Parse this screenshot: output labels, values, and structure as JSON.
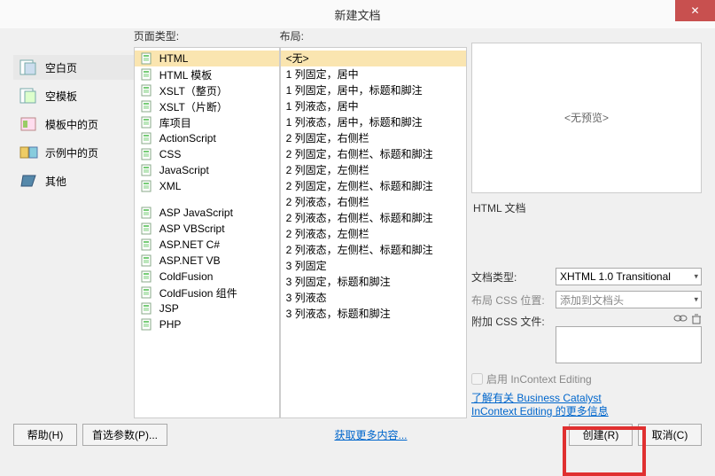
{
  "title": "新建文档",
  "close": "✕",
  "categories_label": "",
  "categories": [
    {
      "label": "空白页",
      "selected": true
    },
    {
      "label": "空模板",
      "selected": false
    },
    {
      "label": "模板中的页",
      "selected": false
    },
    {
      "label": "示例中的页",
      "selected": false
    },
    {
      "label": "其他",
      "selected": false
    }
  ],
  "page_type_label": "页面类型:",
  "page_types_a": [
    "HTML",
    "HTML 模板",
    "XSLT（整页）",
    "XSLT（片断）",
    "库项目",
    "ActionScript",
    "CSS",
    "JavaScript",
    "XML"
  ],
  "page_types_b": [
    "ASP JavaScript",
    "ASP VBScript",
    "ASP.NET C#",
    "ASP.NET VB",
    "ColdFusion",
    "ColdFusion 组件",
    "JSP",
    "PHP"
  ],
  "layout_label": "布局:",
  "layouts": [
    "<无>",
    "1 列固定，居中",
    "1 列固定，居中，标题和脚注",
    "1 列液态，居中",
    "1 列液态，居中，标题和脚注",
    "2 列固定，右侧栏",
    "2 列固定，右侧栏、标题和脚注",
    "2 列固定，左侧栏",
    "2 列固定，左侧栏、标题和脚注",
    "2 列液态，右侧栏",
    "2 列液态，右侧栏、标题和脚注",
    "2 列液态，左侧栏",
    "2 列液态，左侧栏、标题和脚注",
    "3 列固定",
    "3 列固定，标题和脚注",
    "3 列液态",
    "3 列液态，标题和脚注"
  ],
  "preview_none": "<无预览>",
  "preview_desc": "HTML 文档",
  "doctype_label": "文档类型:",
  "doctype_value": "XHTML 1.0 Transitional",
  "csspos_label": "布局 CSS 位置:",
  "csspos_value": "添加到文档头",
  "attachcss_label": "附加 CSS 文件:",
  "incontext_label": "启用 InContext Editing",
  "learn_link_a": "了解有关 Business Catalyst",
  "learn_link_b": "InContext Editing 的更多信息",
  "help_btn": "帮助(H)",
  "prefs_btn": "首选参数(P)...",
  "more_link": "获取更多内容...",
  "create_btn": "创建(R)",
  "cancel_btn": "取消(C)"
}
